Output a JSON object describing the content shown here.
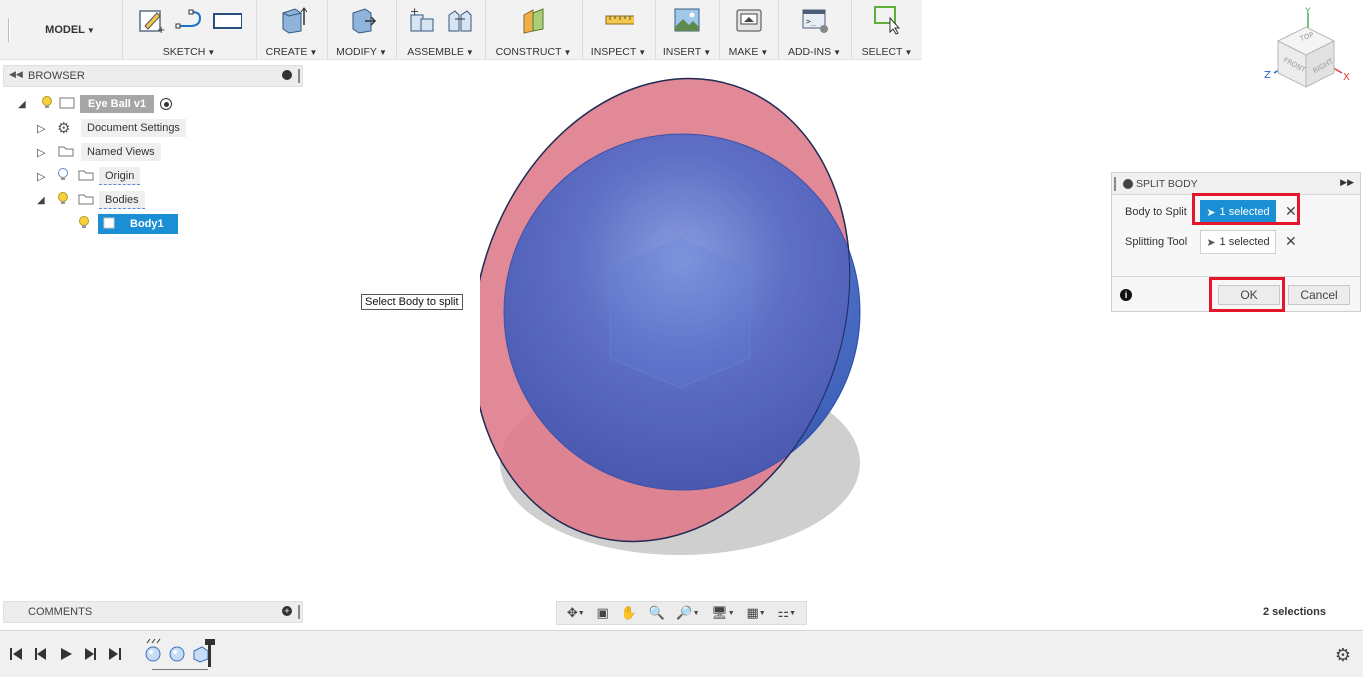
{
  "toolbar": {
    "workspace": "MODEL",
    "groups": [
      {
        "label": "SKETCH"
      },
      {
        "label": "CREATE"
      },
      {
        "label": "MODIFY"
      },
      {
        "label": "ASSEMBLE"
      },
      {
        "label": "CONSTRUCT"
      },
      {
        "label": "INSPECT"
      },
      {
        "label": "INSERT"
      },
      {
        "label": "MAKE"
      },
      {
        "label": "ADD-INS"
      },
      {
        "label": "SELECT"
      }
    ]
  },
  "browser": {
    "title": "BROWSER",
    "root": "Eye Ball v1",
    "items": [
      {
        "label": "Document Settings"
      },
      {
        "label": "Named Views"
      },
      {
        "label": "Origin"
      },
      {
        "label": "Bodies"
      },
      {
        "label": "Body1"
      }
    ]
  },
  "comments": {
    "title": "COMMENTS"
  },
  "tooltip": "Select Body to split",
  "dialog": {
    "title": "SPLIT BODY",
    "body_to_split_label": "Body to Split",
    "body_to_split_value": "1 selected",
    "splitting_tool_label": "Splitting Tool",
    "splitting_tool_value": "1 selected",
    "ok": "OK",
    "cancel": "Cancel"
  },
  "viewcube": {
    "top": "TOP",
    "front": "FRONT",
    "right": "RIGHT",
    "axis_x": "X",
    "axis_y": "Y",
    "axis_z": "Z"
  },
  "status": {
    "selections": "2 selections"
  },
  "colors": {
    "accent": "#1a8fd6",
    "highlight": "#e5162b",
    "sphere": "#3e5fc0",
    "plane": "#f47c7c"
  }
}
